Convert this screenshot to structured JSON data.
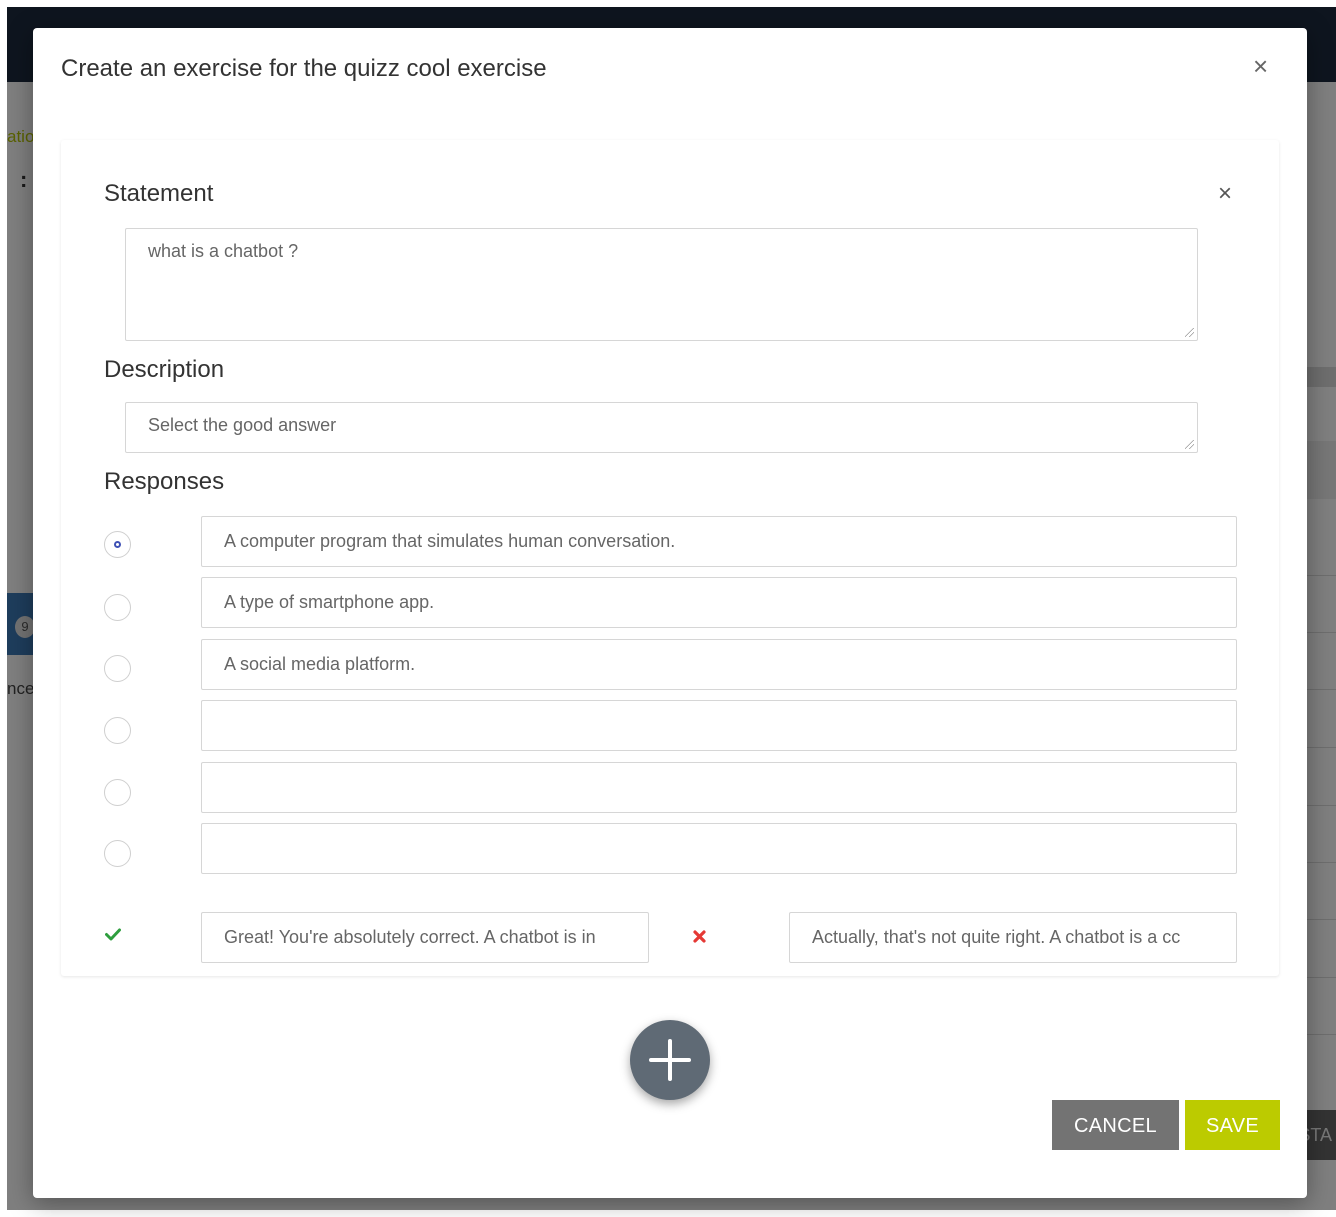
{
  "background": {
    "breadcrumb_fragment": "atio",
    "colon": ":",
    "badge_number": "9",
    "text_fragment": "nce",
    "button_fragment": "STA"
  },
  "modal": {
    "title": "Create an exercise for the quizz cool exercise",
    "close_glyph": "×"
  },
  "card": {
    "close_glyph": "×",
    "statement": {
      "label": "Statement",
      "value": "what is a chatbot ?"
    },
    "description": {
      "label": "Description",
      "value": "Select the good answer"
    },
    "responses": {
      "label": "Responses",
      "selected_index": 0,
      "items": [
        {
          "text": "A computer program that simulates human conversation.",
          "checked": true
        },
        {
          "text": "A type of smartphone app.",
          "checked": false
        },
        {
          "text": "A social media platform.",
          "checked": false
        },
        {
          "text": "",
          "checked": false
        },
        {
          "text": "",
          "checked": false
        },
        {
          "text": "",
          "checked": false
        }
      ]
    },
    "feedback": {
      "correct_icon": "check-icon",
      "correct_text": "Great! You're absolutely correct. A chatbot is in",
      "wrong_icon": "cross-icon",
      "wrong_text": "Actually, that's not quite right. A chatbot is a cc"
    }
  },
  "actions": {
    "add_icon": "plus-icon",
    "cancel_label": "CANCEL",
    "save_label": "SAVE"
  },
  "colors": {
    "accent": "#bccb00",
    "cancel": "#737373",
    "fab": "#5f6a75",
    "radio_selected": "#3f51b5",
    "check": "#2e9e3e",
    "cross": "#e53935",
    "topbar": "#1c2b3e"
  }
}
